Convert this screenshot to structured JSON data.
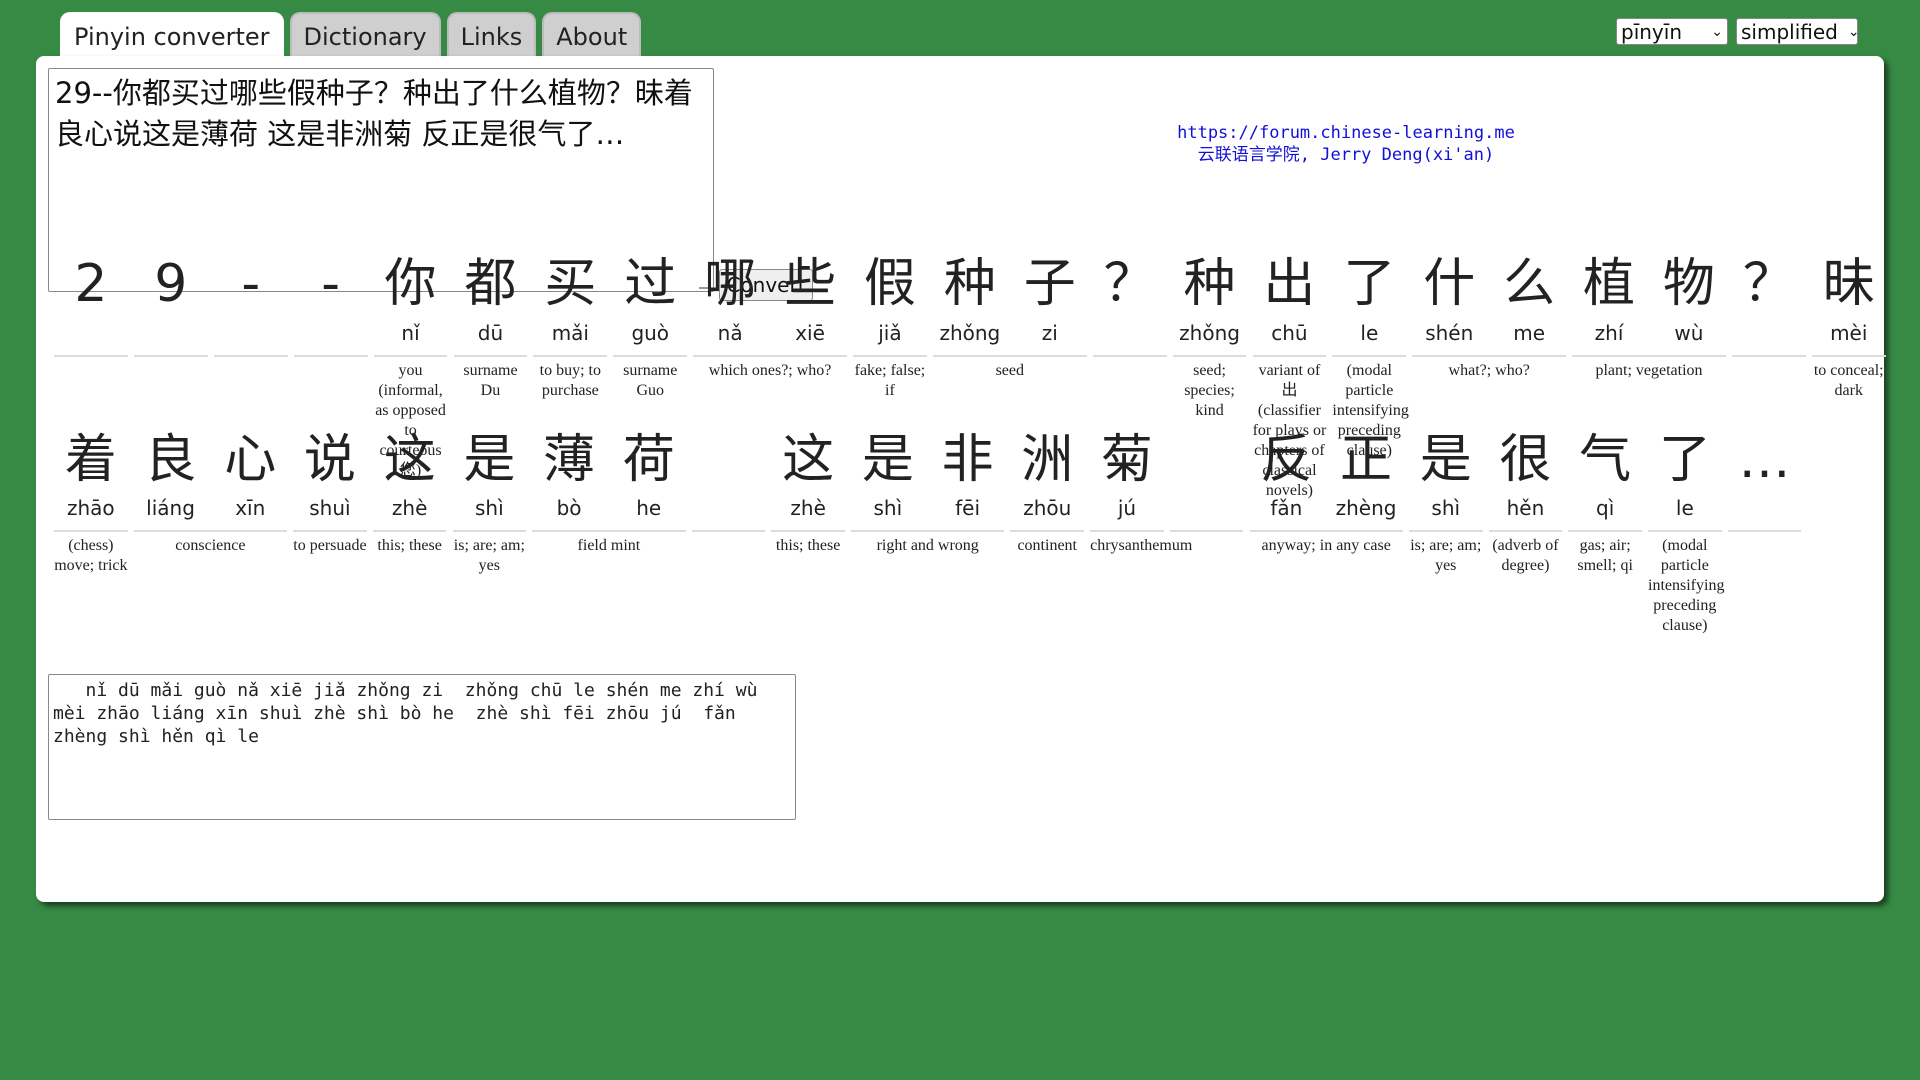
{
  "tabs": [
    "Pinyin converter",
    "Dictionary",
    "Links",
    "About"
  ],
  "selects": {
    "mode": "pīnyīn",
    "script": "simplified"
  },
  "input_text": "29--你都买过哪些假种子？种出了什么植物？昧着良心说这是薄荷 这是非洲菊 反正是很气了…",
  "convert_label": "Convert",
  "credit": {
    "line1": "https://forum.chinese-learning.me",
    "line2": "云联语言学院, Jerry Deng(xi'an)"
  },
  "rows": [
    {
      "chars": [
        {
          "hz": "2",
          "py": ""
        },
        {
          "hz": "9",
          "py": ""
        },
        {
          "hz": "-",
          "py": ""
        },
        {
          "hz": "-",
          "py": ""
        },
        {
          "hz": "你",
          "py": "nǐ"
        },
        {
          "hz": "都",
          "py": "dū"
        },
        {
          "hz": "买",
          "py": "mǎi"
        },
        {
          "hz": "过",
          "py": "guò"
        },
        {
          "hz": "哪",
          "py": "nǎ"
        },
        {
          "hz": "些",
          "py": "xiē"
        },
        {
          "hz": "假",
          "py": "jiǎ"
        },
        {
          "hz": "种",
          "py": "zhǒng"
        },
        {
          "hz": "子",
          "py": "zi"
        },
        {
          "hz": "？",
          "py": ""
        },
        {
          "hz": "种",
          "py": "zhǒng"
        },
        {
          "hz": "出",
          "py": "chū"
        },
        {
          "hz": "了",
          "py": "le"
        },
        {
          "hz": "什",
          "py": "shén"
        },
        {
          "hz": "么",
          "py": "me"
        },
        {
          "hz": "植",
          "py": "zhí"
        },
        {
          "hz": "物",
          "py": "wù"
        },
        {
          "hz": "？",
          "py": ""
        },
        {
          "hz": "昧",
          "py": "mèi"
        }
      ],
      "words": [
        {
          "span": 1,
          "def": ""
        },
        {
          "span": 1,
          "def": ""
        },
        {
          "span": 1,
          "def": ""
        },
        {
          "span": 1,
          "def": ""
        },
        {
          "span": 1,
          "def": "you (informal, as opposed to courteous 您)"
        },
        {
          "span": 1,
          "def": "surname Du"
        },
        {
          "span": 1,
          "def": "to buy; to purchase"
        },
        {
          "span": 1,
          "def": "surname Guo"
        },
        {
          "span": 2,
          "def": "which ones?; who?"
        },
        {
          "span": 1,
          "def": "fake; false; if"
        },
        {
          "span": 2,
          "def": "seed"
        },
        {
          "span": 1,
          "def": ""
        },
        {
          "span": 1,
          "def": "seed; species; kind"
        },
        {
          "span": 1,
          "def": "variant of 出 (classifier for plays or chapters of classical novels)"
        },
        {
          "span": 1,
          "def": "(modal particle intensifying preceding clause)"
        },
        {
          "span": 2,
          "def": "what?; who?"
        },
        {
          "span": 2,
          "def": "plant; vegetation"
        },
        {
          "span": 1,
          "def": ""
        },
        {
          "span": 1,
          "def": "to conceal; dark"
        }
      ]
    },
    {
      "chars": [
        {
          "hz": "着",
          "py": "zhāo"
        },
        {
          "hz": "良",
          "py": "liáng"
        },
        {
          "hz": "心",
          "py": "xīn"
        },
        {
          "hz": "说",
          "py": "shuì"
        },
        {
          "hz": "这",
          "py": "zhè"
        },
        {
          "hz": "是",
          "py": "shì"
        },
        {
          "hz": "薄",
          "py": "bò"
        },
        {
          "hz": "荷",
          "py": "he"
        },
        {
          "hz": "",
          "py": ""
        },
        {
          "hz": "这",
          "py": "zhè"
        },
        {
          "hz": "是",
          "py": "shì"
        },
        {
          "hz": "非",
          "py": "fēi"
        },
        {
          "hz": "洲",
          "py": "zhōu"
        },
        {
          "hz": "菊",
          "py": "jú"
        },
        {
          "hz": "",
          "py": ""
        },
        {
          "hz": "反",
          "py": "fǎn"
        },
        {
          "hz": "正",
          "py": "zhèng"
        },
        {
          "hz": "是",
          "py": "shì"
        },
        {
          "hz": "很",
          "py": "hěn"
        },
        {
          "hz": "气",
          "py": "qì"
        },
        {
          "hz": "了",
          "py": "le"
        },
        {
          "hz": "…",
          "py": ""
        }
      ],
      "words": [
        {
          "span": 1,
          "def": "(chess) move; trick"
        },
        {
          "span": 2,
          "def": "conscience"
        },
        {
          "span": 1,
          "def": "to persuade"
        },
        {
          "span": 1,
          "def": "this; these"
        },
        {
          "span": 1,
          "def": "is; are; am; yes"
        },
        {
          "span": 2,
          "def": "field mint"
        },
        {
          "span": 1,
          "def": ""
        },
        {
          "span": 1,
          "def": "this; these"
        },
        {
          "span": 2,
          "def": "right and wrong"
        },
        {
          "span": 1,
          "def": "continent"
        },
        {
          "span": 1,
          "def": "chrysanthemum"
        },
        {
          "span": 1,
          "def": ""
        },
        {
          "span": 2,
          "def": "anyway; in any case"
        },
        {
          "span": 1,
          "def": "is; are; am; yes"
        },
        {
          "span": 1,
          "def": "(adverb of degree)"
        },
        {
          "span": 1,
          "def": "gas; air; smell; qi"
        },
        {
          "span": 1,
          "def": "(modal particle intensifying preceding clause)"
        },
        {
          "span": 1,
          "def": ""
        }
      ]
    }
  ],
  "output_text": "   nǐ dū mǎi guò nǎ xiē jiǎ zhǒng zi  zhǒng chū le shén me zhí wù  mèi zhāo liáng xīn shuì zhè shì bò he  zhè shì fēi zhōu jú  fǎn zhèng shì hěn qì le"
}
